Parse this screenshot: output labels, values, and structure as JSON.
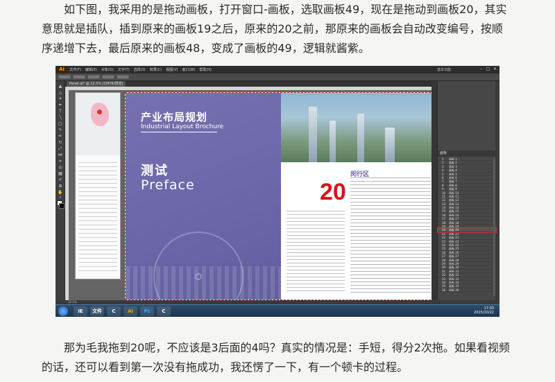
{
  "article": {
    "paragraph_top": "如下图，我采用的是拖动画板，打开窗口-画板，选取画板49，现在是拖动到画板20，其实意思就是插队，插到原来的画板19之后，原来的20之前，那原来的画板会自动改变编号，按顺序递增下去，最后原来的画板48，变成了画板的49，逻辑就酱紫。",
    "paragraph_bottom": "那为毛我拖到20呢，不应该是3后面的4吗？真实的情况是：手短，得分2次拖。如果看视频的话，还可以看到第一次没有拖成功，我还愣了一下，有一个顿卡的过程。"
  },
  "app": {
    "logo": "Ai",
    "menu": [
      "文件(F)",
      "编辑(E)",
      "对象(O)",
      "文字(T)",
      "选择(S)",
      "效果(C)",
      "视图(V)",
      "窗口(W)",
      "帮助(H)"
    ],
    "workspace": "基本功能",
    "doc_tab": "Panel.ai* @ 12.5% (CMYK/预览)",
    "status": "12.5%",
    "window_controls": [
      "–",
      "□",
      "✕"
    ]
  },
  "document": {
    "cover_title_cn": "产业布局规划",
    "cover_title_en": "Industrial Layout Brochure",
    "test_cn": "测试",
    "test_en": "Preface",
    "page_number": "20",
    "district_heading": "闵行区"
  },
  "artboards_panel": {
    "title": "画板",
    "rows": [
      {
        "num": "1",
        "name": "画板 1"
      },
      {
        "num": "2",
        "name": "画板 2"
      },
      {
        "num": "3",
        "name": "画板 3"
      },
      {
        "num": "4",
        "name": "画板 4"
      },
      {
        "num": "5",
        "name": "画板 5"
      },
      {
        "num": "6",
        "name": "画板 6"
      },
      {
        "num": "7",
        "name": "画板 7"
      },
      {
        "num": "8",
        "name": "画板 8"
      },
      {
        "num": "9",
        "name": "画板 9"
      },
      {
        "num": "10",
        "name": "画板 10"
      },
      {
        "num": "11",
        "name": "画板 11"
      },
      {
        "num": "12",
        "name": "画板 12"
      },
      {
        "num": "13",
        "name": "画板 13"
      },
      {
        "num": "14",
        "name": "画板 14"
      },
      {
        "num": "15",
        "name": "画板 15"
      },
      {
        "num": "16",
        "name": "画板 16"
      },
      {
        "num": "17",
        "name": "画板 17"
      },
      {
        "num": "18",
        "name": "画板 18"
      },
      {
        "num": "19",
        "name": "画板 19"
      },
      {
        "num": "20",
        "name": "画板 49"
      },
      {
        "num": "21",
        "name": "画板 21"
      },
      {
        "num": "22",
        "name": "画板 22"
      },
      {
        "num": "23",
        "name": "画板 23"
      },
      {
        "num": "24",
        "name": "画板 24"
      },
      {
        "num": "25",
        "name": "画板 25"
      },
      {
        "num": "26",
        "name": "画板 26"
      },
      {
        "num": "27",
        "name": "画板 27"
      },
      {
        "num": "28",
        "name": "画板 28"
      },
      {
        "num": "29",
        "name": "画板 29"
      },
      {
        "num": "30",
        "name": "画板 30"
      },
      {
        "num": "31",
        "name": "画板 31"
      },
      {
        "num": "32",
        "name": "画板 32"
      },
      {
        "num": "33",
        "name": "画板 33"
      },
      {
        "num": "34",
        "name": "画板 34"
      },
      {
        "num": "35",
        "name": "画板 35"
      },
      {
        "num": "36",
        "name": "画板 36"
      }
    ],
    "selected_index": 19
  },
  "taskbar": {
    "time": "17:03",
    "date": "2015/10/22",
    "apps": [
      "IE",
      "文件",
      "C",
      "Ai",
      "Ps",
      "C"
    ]
  },
  "colors": {
    "brochure_purple": "#6b66a8",
    "page_number_red": "#d9131b",
    "app_logo_orange": "#ff9a00"
  }
}
